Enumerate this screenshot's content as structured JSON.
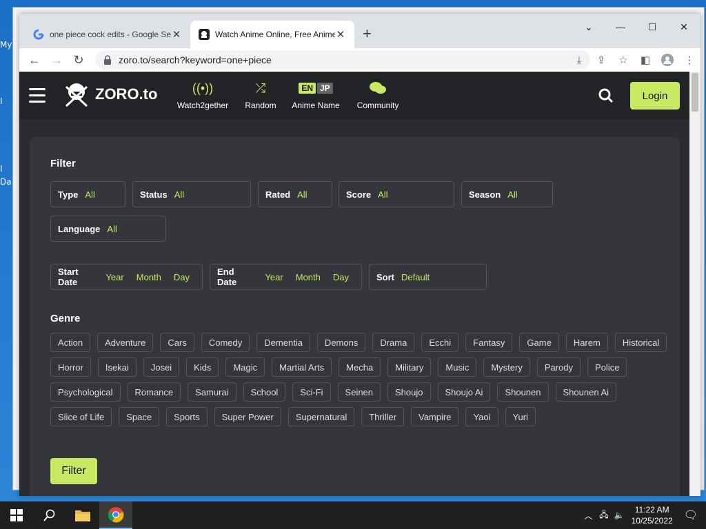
{
  "desktop": {
    "labels": [
      "My",
      "I",
      "I",
      "Da"
    ]
  },
  "tabs": [
    {
      "title": "one piece cock edits - Google Se",
      "active": false
    },
    {
      "title": "Watch Anime Online, Free Anime S",
      "active": true
    }
  ],
  "address": {
    "url": "zoro.to/search?keyword=one+piece"
  },
  "site": {
    "logo": "ZORO.to",
    "nav": [
      {
        "label": "Watch2gether",
        "icon": "broadcast-icon"
      },
      {
        "label": "Random",
        "icon": "shuffle-icon"
      },
      {
        "label": "Anime Name",
        "icon": "language-toggle",
        "en": "EN",
        "jp": "JP"
      },
      {
        "label": "Community",
        "icon": "chat-icon"
      }
    ],
    "login_label": "Login"
  },
  "filter": {
    "title": "Filter",
    "fields": [
      {
        "label": "Type",
        "value": "All"
      },
      {
        "label": "Status",
        "value": "All"
      },
      {
        "label": "Rated",
        "value": "All"
      },
      {
        "label": "Score",
        "value": "All"
      },
      {
        "label": "Season",
        "value": "All"
      },
      {
        "label": "Language",
        "value": "All"
      }
    ],
    "start_date": {
      "label": "Start Date",
      "year": "Year",
      "month": "Month",
      "day": "Day"
    },
    "end_date": {
      "label": "End Date",
      "year": "Year",
      "month": "Month",
      "day": "Day"
    },
    "sort": {
      "label": "Sort",
      "value": "Default"
    },
    "genre_title": "Genre",
    "genres": [
      "Action",
      "Adventure",
      "Cars",
      "Comedy",
      "Dementia",
      "Demons",
      "Drama",
      "Ecchi",
      "Fantasy",
      "Game",
      "Harem",
      "Historical",
      "Horror",
      "Isekai",
      "Josei",
      "Kids",
      "Magic",
      "Martial Arts",
      "Mecha",
      "Military",
      "Music",
      "Mystery",
      "Parody",
      "Police",
      "Psychological",
      "Romance",
      "Samurai",
      "School",
      "Sci-Fi",
      "Seinen",
      "Shoujo",
      "Shoujo Ai",
      "Shounen",
      "Shounen Ai",
      "Slice of Life",
      "Space",
      "Sports",
      "Super Power",
      "Supernatural",
      "Thriller",
      "Vampire",
      "Yaoi",
      "Yuri"
    ],
    "submit_label": "Filter"
  },
  "taskbar": {
    "time": "11:22 AM",
    "date": "10/25/2022"
  },
  "colors": {
    "accent": "#cae962",
    "page_bg": "#2a2c31",
    "panel_bg": "#34363c"
  }
}
